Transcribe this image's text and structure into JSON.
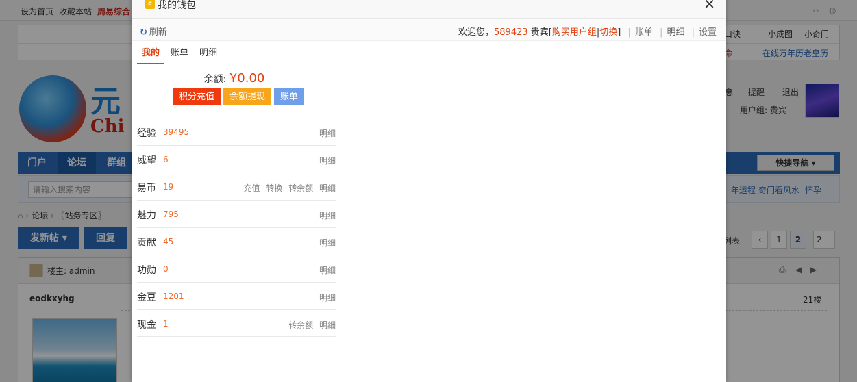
{
  "background": {
    "topbar": {
      "set_home": "设为首页",
      "bookmark": "收藏本站",
      "promo": "周易综合"
    },
    "nav_links_right": [
      "口诀",
      "小成图",
      "小奇门"
    ],
    "nav_links_right2": [
      "命",
      "在线万年历老皇历"
    ],
    "logo": {
      "text": "元",
      "sub": "Chi"
    },
    "user_area": {
      "messages": "息",
      "remind": "提醒",
      "logout": "退出",
      "usergroup": "用户组: 贵宾"
    },
    "main_nav": [
      "门户",
      "论坛",
      "群组"
    ],
    "quick_nav": "快捷导航",
    "search_placeholder": "请输入搜索内容",
    "search_links": [
      "年运程",
      "奇门看风水",
      "怀孕"
    ],
    "breadcrumb": [
      "论坛",
      "〖站务专区〗"
    ],
    "buttons": {
      "new_post": "发新帖",
      "reply": "回复"
    },
    "pagination": {
      "list": "列表",
      "pages": [
        "1",
        "2"
      ],
      "input": "2"
    },
    "post": {
      "author_label": "楼主: admin",
      "title": "eodkxyhg",
      "floor": "21楼"
    }
  },
  "dialog": {
    "title": "我的钱包",
    "toolbar": {
      "refresh": "刷新",
      "welcome": "欢迎您，",
      "user_id": "589423",
      "user_name": "贵宾[",
      "buy_group": "购买用户组",
      "pipe": "|",
      "switch": "切换",
      "close_bracket": "]",
      "links": [
        "账单",
        "明细",
        "设置"
      ]
    },
    "tabs": [
      "我的",
      "账单",
      "明细"
    ],
    "balance": {
      "label": "余额: ",
      "amount": "¥0.00"
    },
    "actions": {
      "recharge": "积分充值",
      "withdraw": "余额提现",
      "bill": "账单"
    },
    "items": [
      {
        "label": "经验",
        "value": "39495",
        "links": [
          "明细"
        ]
      },
      {
        "label": "威望",
        "value": "6",
        "links": [
          "明细"
        ]
      },
      {
        "label": "易币",
        "value": "19",
        "links": [
          "充值",
          "转换",
          "转余额",
          "明细"
        ]
      },
      {
        "label": "魅力",
        "value": "795",
        "links": [
          "明细"
        ]
      },
      {
        "label": "贡献",
        "value": "45",
        "links": [
          "明细"
        ]
      },
      {
        "label": "功勋",
        "value": "0",
        "links": [
          "明细"
        ]
      },
      {
        "label": "金豆",
        "value": "1201",
        "links": [
          "明细"
        ]
      },
      {
        "label": "现金",
        "value": "1",
        "links": [
          "转余额",
          "明细"
        ]
      }
    ]
  },
  "colors": {
    "accent": "#e2400e",
    "value": "#f06a2a",
    "forum_blue": "#2b6cb9"
  }
}
